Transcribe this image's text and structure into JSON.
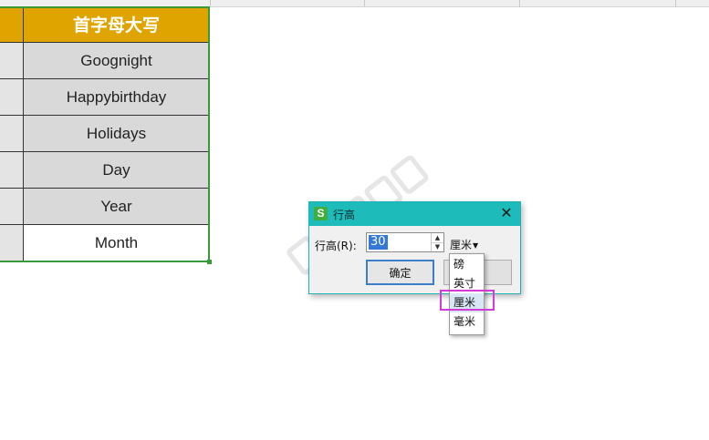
{
  "sheet": {
    "header": "首字母大写",
    "rows": [
      "Goognight",
      "Happybirthday",
      "Holidays",
      "Day",
      "Year",
      "Month"
    ]
  },
  "dialog": {
    "app_icon_letter": "S",
    "title": "行高",
    "close_glyph": "✕",
    "row_height_label": "行高(R):",
    "row_height_value": "30",
    "unit_selected": "厘米",
    "ok_label": "确定"
  },
  "unit_options": [
    "磅",
    "英寸",
    "厘米",
    "毫米"
  ],
  "highlighted_option": "厘米",
  "colors": {
    "header_fill": "#e0a400",
    "selection_border": "#3a9a3a",
    "titlebar": "#1ebbbb",
    "annotation": "#d43bd4"
  },
  "icons": {
    "app": "wps-spreadsheet-icon",
    "close": "close-icon",
    "spin_up": "triangle-up-icon",
    "spin_down": "triangle-down-icon",
    "dropdown": "caret-down-icon"
  }
}
